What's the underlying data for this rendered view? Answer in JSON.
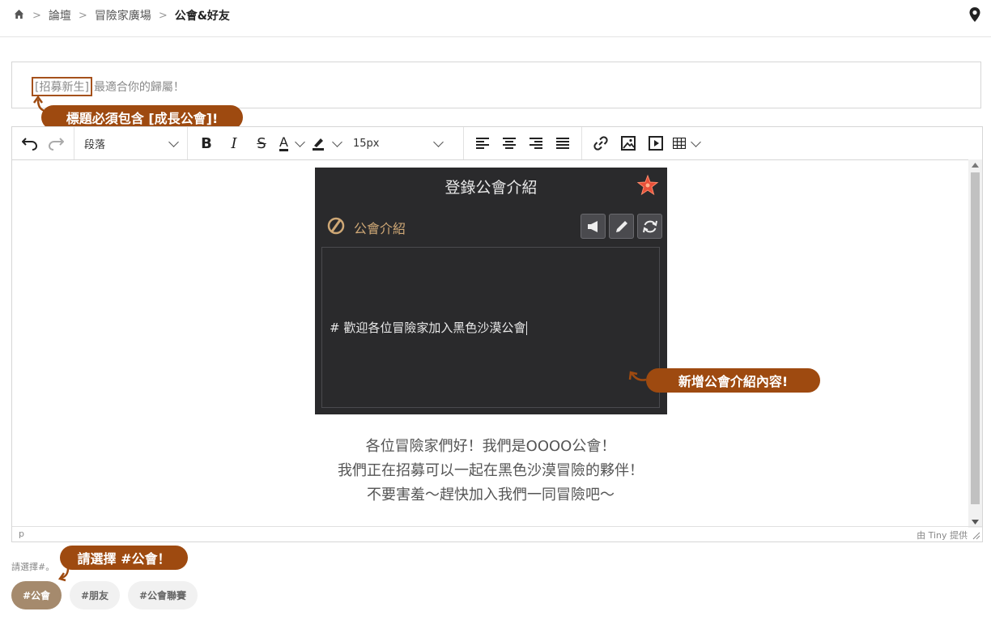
{
  "breadcrumb": {
    "items": [
      "論壇",
      "冒險家廣場",
      "公會&好友"
    ]
  },
  "title_field": {
    "highlight": "[招募新生]",
    "rest": "最適合你的歸屬！"
  },
  "callouts": {
    "title": "標題必須包含 [成長公會]!",
    "content": "新增公會介紹內容!",
    "tag": "請選擇 #公會！"
  },
  "toolbar": {
    "block_format": "段落",
    "font_size": "15px"
  },
  "game": {
    "title": "登錄公會介紹",
    "subtitle": "公會介紹",
    "line": "# 歡迎各位冒險家加入黑色沙漠公會"
  },
  "content": {
    "line1": "各位冒險家們好！我們是OOOO公會！",
    "line2": "我們正在招募可以一起在黑色沙漠冒險的夥伴！",
    "line3": "不要害羞～趕快加入我們一同冒險吧～"
  },
  "statusbar": {
    "path": "p",
    "brand": "由 Tiny 提供"
  },
  "tags": {
    "hint": "請選擇#。",
    "items": [
      "#公會",
      "#朋友",
      "#公會聯賽"
    ]
  },
  "colors": {
    "accent": "#9e4a10",
    "tag_active": "#a58a6d"
  }
}
